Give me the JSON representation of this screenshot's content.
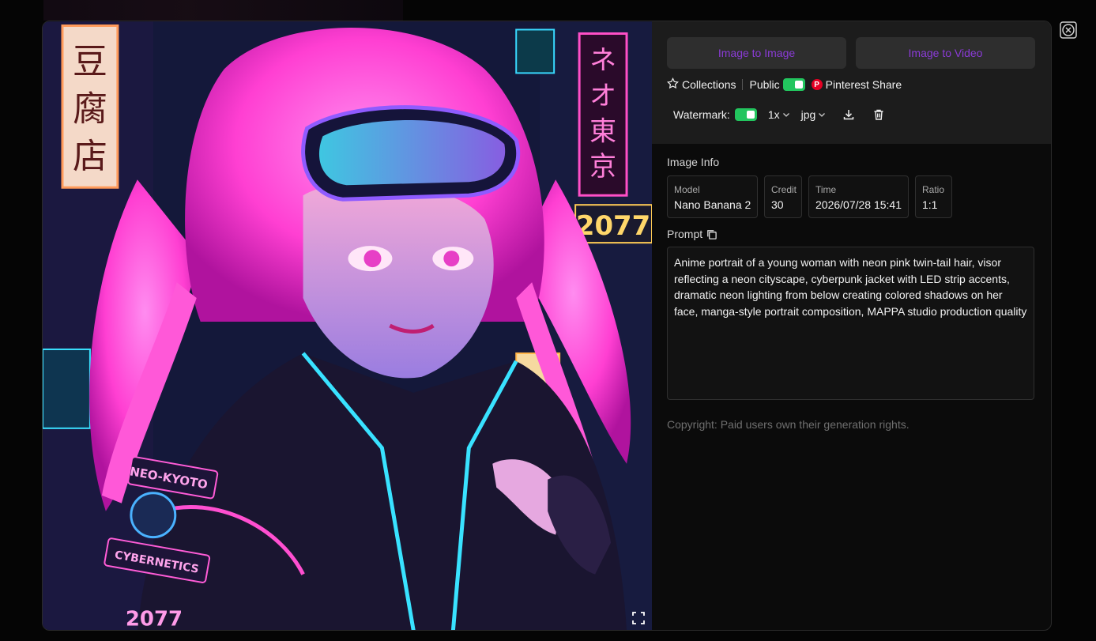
{
  "actions": {
    "image_to_image": "Image to Image",
    "image_to_video": "Image to Video"
  },
  "meta": {
    "collections": "Collections",
    "public": "Public",
    "pinterest": "Pinterest Share",
    "public_on": true
  },
  "download": {
    "watermark_label": "Watermark:",
    "watermark_on": true,
    "scale": "1x",
    "format": "jpg"
  },
  "info": {
    "title": "Image Info",
    "cards": [
      {
        "label": "Model",
        "value": "Nano Banana 2"
      },
      {
        "label": "Credit",
        "value": "30"
      },
      {
        "label": "Time",
        "value": "2026/07/28 15:41"
      },
      {
        "label": "Ratio",
        "value": "1:1"
      }
    ]
  },
  "prompt": {
    "title": "Prompt",
    "text": "Anime portrait of a young woman with neon pink twin-tail hair, visor reflecting a neon cityscape, cyberpunk jacket with LED strip accents, dramatic neon lighting from below creating colored shadows on her face, manga-style portrait composition, MAPPA studio production quality"
  },
  "copyright": "Copyright: Paid users own their generation rights.",
  "image": {
    "signs": [
      "豆腐店",
      "ネオ東京",
      "2077",
      "NEO-KYOTO",
      "CYBERNETICS",
      "2077"
    ]
  },
  "colors": {
    "accent": "#8a3bd6",
    "toggle": "#22c55e",
    "pinterest": "#e60023"
  },
  "icons": [
    "star-icon",
    "pinterest-icon",
    "chevron-down-icon",
    "download-icon",
    "trash-icon",
    "copy-icon",
    "expand-icon",
    "close-icon"
  ]
}
